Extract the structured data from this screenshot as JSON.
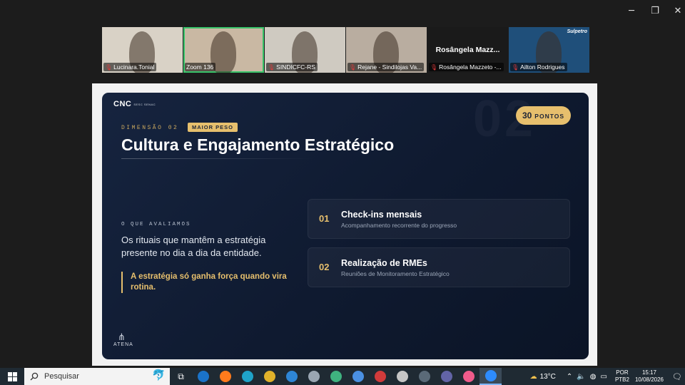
{
  "window": {
    "minimize": "─",
    "restore": "❐",
    "close": "✕"
  },
  "participants": [
    {
      "name": "Lucinara.Tonial",
      "muted": true,
      "bg": "#d9d2c6"
    },
    {
      "name": "Zoom 136",
      "muted": false,
      "active": true,
      "bg": "#c9b8a3"
    },
    {
      "name": "SINDICFC-RS",
      "muted": true,
      "bg": "#cfcac1"
    },
    {
      "name": "Rejane - Sindilojas Va...",
      "muted": true,
      "bg": "#b9ada0"
    },
    {
      "name": "Rosângela Mazzeto -...",
      "display_name": "Rosângela  Mazz...",
      "muted": true,
      "bg": "#1a1a1a"
    },
    {
      "name": "Ailton Rodrigues",
      "muted": true,
      "bg": "#1f4f7a",
      "corner_logo": "Sulpetro"
    }
  ],
  "slide": {
    "logo": "CNC",
    "logo_sub": "SESC SENAC",
    "watermark": "02",
    "points_value": "30",
    "points_unit": "PONTOS",
    "dimension_label": "DIMENSÃO 02",
    "badge": "MAIOR PESO",
    "title": "Cultura e Engajamento Estratégico",
    "section_label": "O QUE AVALIAMOS",
    "description": "Os rituais que mantêm a estratégia presente no dia a dia da entidade.",
    "quote": "A estratégia só ganha força quando vira rotina.",
    "cards": [
      {
        "num": "01",
        "title": "Check-ins mensais",
        "subtitle": "Acompanhamento recorrente do progresso"
      },
      {
        "num": "02",
        "title": "Realização de RMEs",
        "subtitle": "Reuniões de Monitoramento Estratégico"
      }
    ],
    "footer_logo": "ATENA"
  },
  "taskbar": {
    "search_placeholder": "Pesquisar",
    "apps": [
      {
        "name": "task-view",
        "glyph": "⧉",
        "color": "#ffffff"
      },
      {
        "name": "outlook",
        "color": "#1a73c9"
      },
      {
        "name": "firefox",
        "color": "#ff7b1c"
      },
      {
        "name": "edge",
        "color": "#1fa3c9"
      },
      {
        "name": "chrome",
        "color": "#e0b12a"
      },
      {
        "name": "app-blue",
        "color": "#2e86d6"
      },
      {
        "name": "app-1",
        "color": "#9aa6b2"
      },
      {
        "name": "app-2",
        "color": "#3fb27f"
      },
      {
        "name": "app-3",
        "color": "#4a90e2"
      },
      {
        "name": "app-4",
        "color": "#d13b3b"
      },
      {
        "name": "app-5",
        "color": "#c6c6c6"
      },
      {
        "name": "calculator",
        "color": "#5a6a78"
      },
      {
        "name": "teams",
        "color": "#6264a7"
      },
      {
        "name": "itunes",
        "color": "#f05b8b"
      },
      {
        "name": "zoom",
        "color": "#2d8cff",
        "active": true
      }
    ],
    "temperature": "13°C",
    "lang_1": "POR",
    "lang_2": "PTB2",
    "time": "15:17",
    "date": "10/08/2026"
  }
}
